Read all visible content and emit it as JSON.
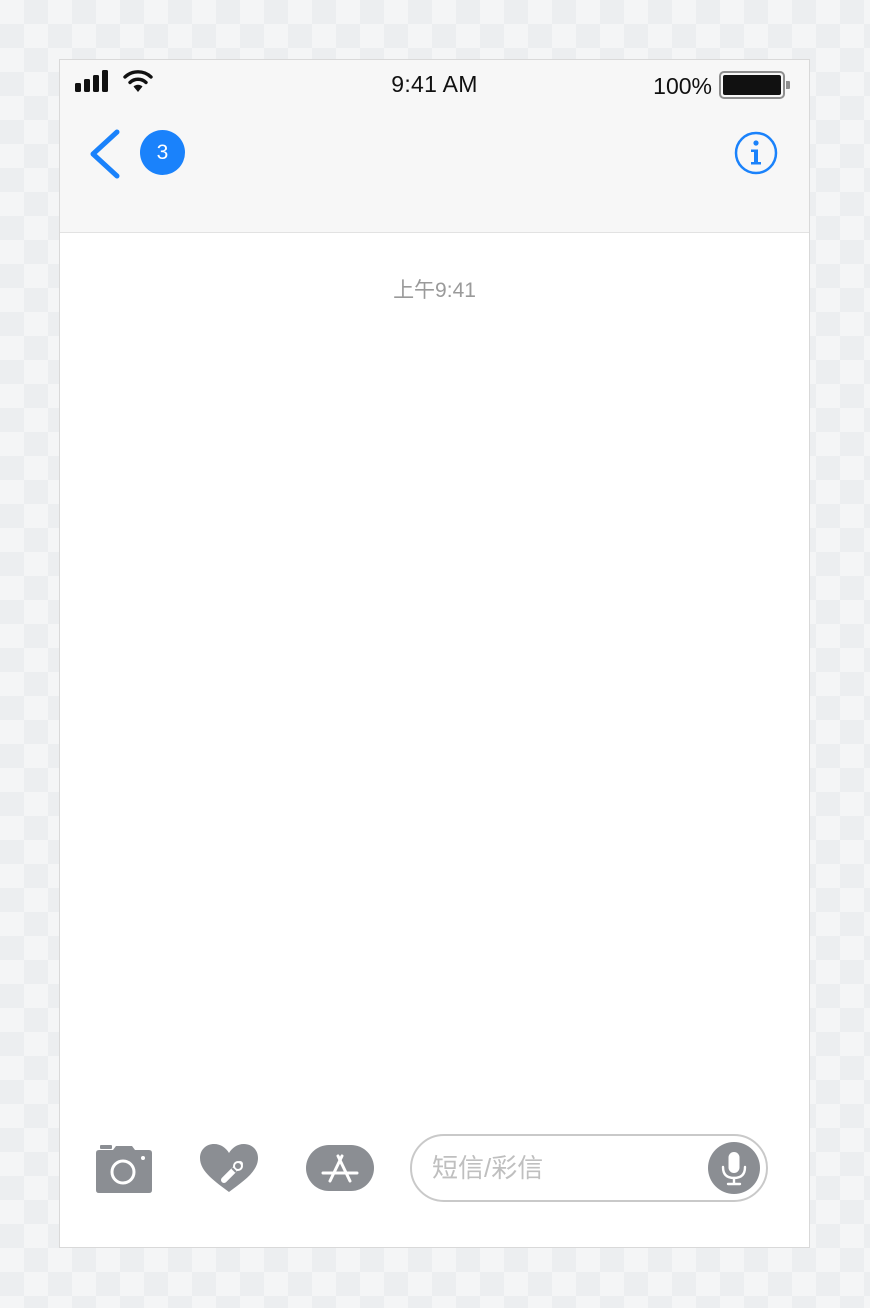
{
  "status_bar": {
    "time": "9:41 AM",
    "battery_percent": "100%",
    "signal_icon": "signal-bars-icon",
    "wifi_icon": "wifi-icon",
    "battery_icon": "battery-full-icon"
  },
  "nav": {
    "back_icon": "chevron-left-icon",
    "unread_count": "3",
    "info_icon": "info-icon",
    "accent_color": "#1a82fb"
  },
  "conversation": {
    "timestamp": "上午9:41"
  },
  "toolbar": {
    "camera_icon": "camera-icon",
    "digital_touch_icon": "heart-touch-icon",
    "app_store_icon": "app-store-icon",
    "message_placeholder": "短信/彩信",
    "mic_icon": "microphone-icon"
  }
}
